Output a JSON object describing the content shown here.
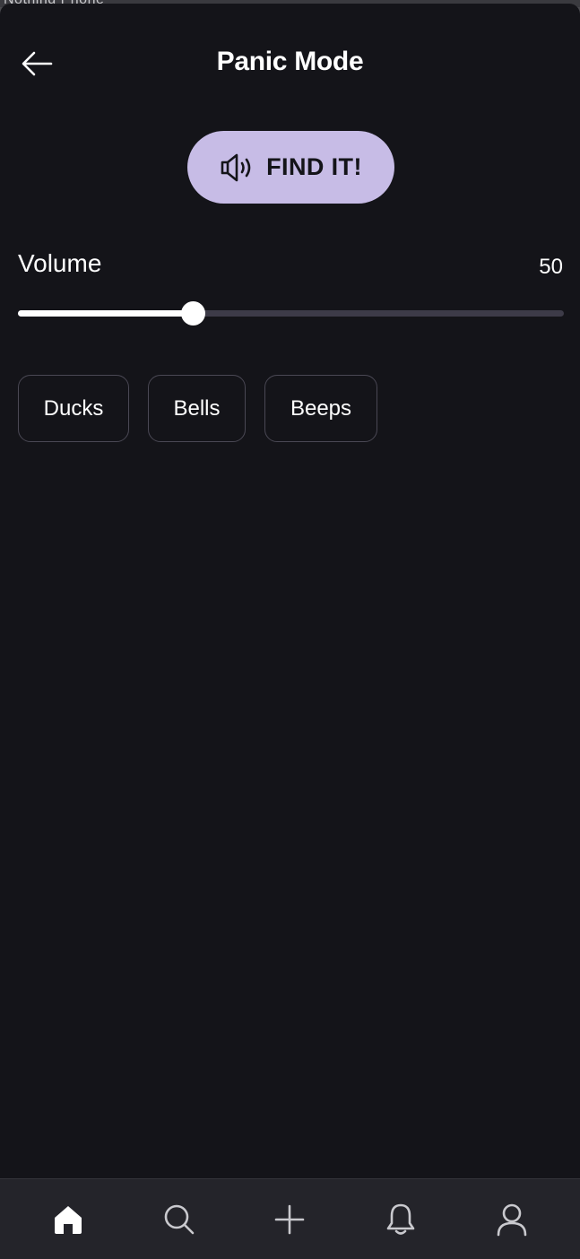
{
  "status_bar": {
    "text": "Nothing Phone"
  },
  "header": {
    "title": "Panic Mode",
    "back_icon": "arrow-left-icon"
  },
  "find_button": {
    "label": "FIND IT!",
    "icon": "speaker-icon"
  },
  "volume": {
    "label": "Volume",
    "value": "50",
    "slider_fraction": 0.32
  },
  "sounds": {
    "options": [
      {
        "label": "Ducks"
      },
      {
        "label": "Bells"
      },
      {
        "label": "Beeps"
      }
    ]
  },
  "bottom_nav": {
    "items": [
      {
        "name": "home",
        "icon": "home-icon",
        "active": true
      },
      {
        "name": "search",
        "icon": "search-icon",
        "active": false
      },
      {
        "name": "add",
        "icon": "plus-icon",
        "active": false
      },
      {
        "name": "notifications",
        "icon": "bell-icon",
        "active": false
      },
      {
        "name": "profile",
        "icon": "user-icon",
        "active": false
      }
    ]
  },
  "colors": {
    "background": "#141419",
    "accent": "#c7bce6",
    "nav_background": "#24242a",
    "track": "#3d3b48"
  }
}
